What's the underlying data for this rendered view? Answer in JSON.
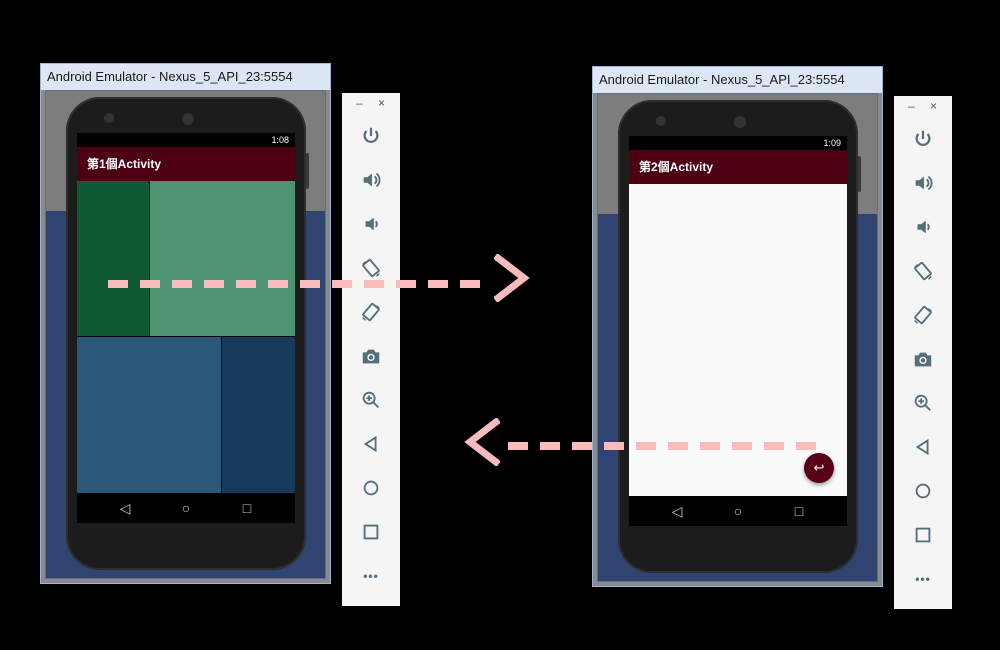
{
  "left_emulator": {
    "title": "Android Emulator - Nexus_5_API_23:5554",
    "status_time": "1:08",
    "app_title": "第1個Activity",
    "tile_colors": [
      "#0f5a35",
      "#4e9473",
      "#2b5878",
      "#163a5a"
    ]
  },
  "right_emulator": {
    "title": "Android Emulator - Nexus_5_API_23:5554",
    "status_time": "1:09",
    "app_title": "第2個Activity",
    "fab_icon": "undo-icon"
  },
  "toolbar": {
    "minimize": "–",
    "close": "×",
    "items": [
      "power-icon",
      "volume-up-icon",
      "volume-down-icon",
      "rotate-left-icon",
      "rotate-right-icon",
      "camera-icon",
      "zoom-icon",
      "back-icon",
      "home-icon",
      "overview-icon",
      "more-icon"
    ],
    "more_label": "•••"
  },
  "nav": {
    "back": "◁",
    "home": "○",
    "overview": "□"
  },
  "colors": {
    "appbar": "#4d0011",
    "arrow": "#f8bcbc",
    "toolbar_icon": "#546e7a"
  }
}
